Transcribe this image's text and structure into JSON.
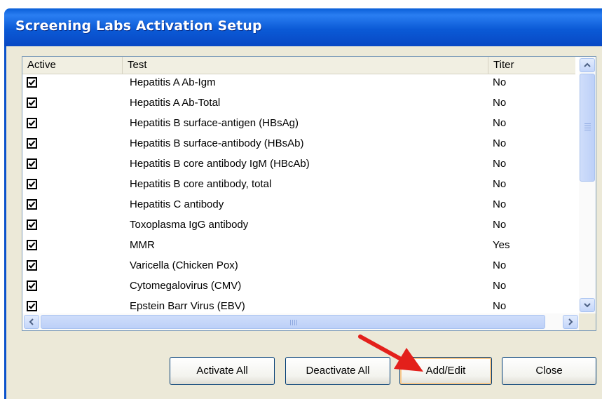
{
  "window": {
    "title": "Screening Labs Activation Setup"
  },
  "table": {
    "columns": [
      "Active",
      "Test",
      "Titer"
    ],
    "rows": [
      {
        "active": true,
        "test": "Hepatitis A Ab-Igm",
        "titer": "No"
      },
      {
        "active": true,
        "test": "Hepatitis A Ab-Total",
        "titer": "No"
      },
      {
        "active": true,
        "test": "Hepatitis B surface-antigen (HBsAg)",
        "titer": "No"
      },
      {
        "active": true,
        "test": "Hepatitis B surface-antibody (HBsAb)",
        "titer": "No"
      },
      {
        "active": true,
        "test": "Hepatitis B core antibody IgM (HBcAb)",
        "titer": "No"
      },
      {
        "active": true,
        "test": "Hepatitis B core antibody, total",
        "titer": "No"
      },
      {
        "active": true,
        "test": "Hepatitis C antibody",
        "titer": "No"
      },
      {
        "active": true,
        "test": "Toxoplasma IgG antibody",
        "titer": "No"
      },
      {
        "active": true,
        "test": "MMR",
        "titer": "Yes"
      },
      {
        "active": true,
        "test": "Varicella (Chicken Pox)",
        "titer": "No"
      },
      {
        "active": true,
        "test": "Cytomegalovirus (CMV)",
        "titer": "No"
      },
      {
        "active": true,
        "test": "Epstein Barr Virus (EBV)",
        "titer": "No"
      }
    ]
  },
  "buttons": {
    "activate_all": "Activate All",
    "deactivate_all": "Deactivate All",
    "add_edit": "Add/Edit",
    "close": "Close"
  },
  "icons": {
    "checkbox": "checkbox-checked-icon",
    "scroll_up": "chevron-up-icon",
    "scroll_down": "chevron-down-icon",
    "scroll_left": "chevron-left-icon",
    "scroll_right": "chevron-right-icon",
    "annotation": "red-arrow-icon"
  },
  "colors": {
    "title_bar": "#0b5ad6",
    "dialog_face": "#ece9d8",
    "arrow": "#e3201b"
  }
}
